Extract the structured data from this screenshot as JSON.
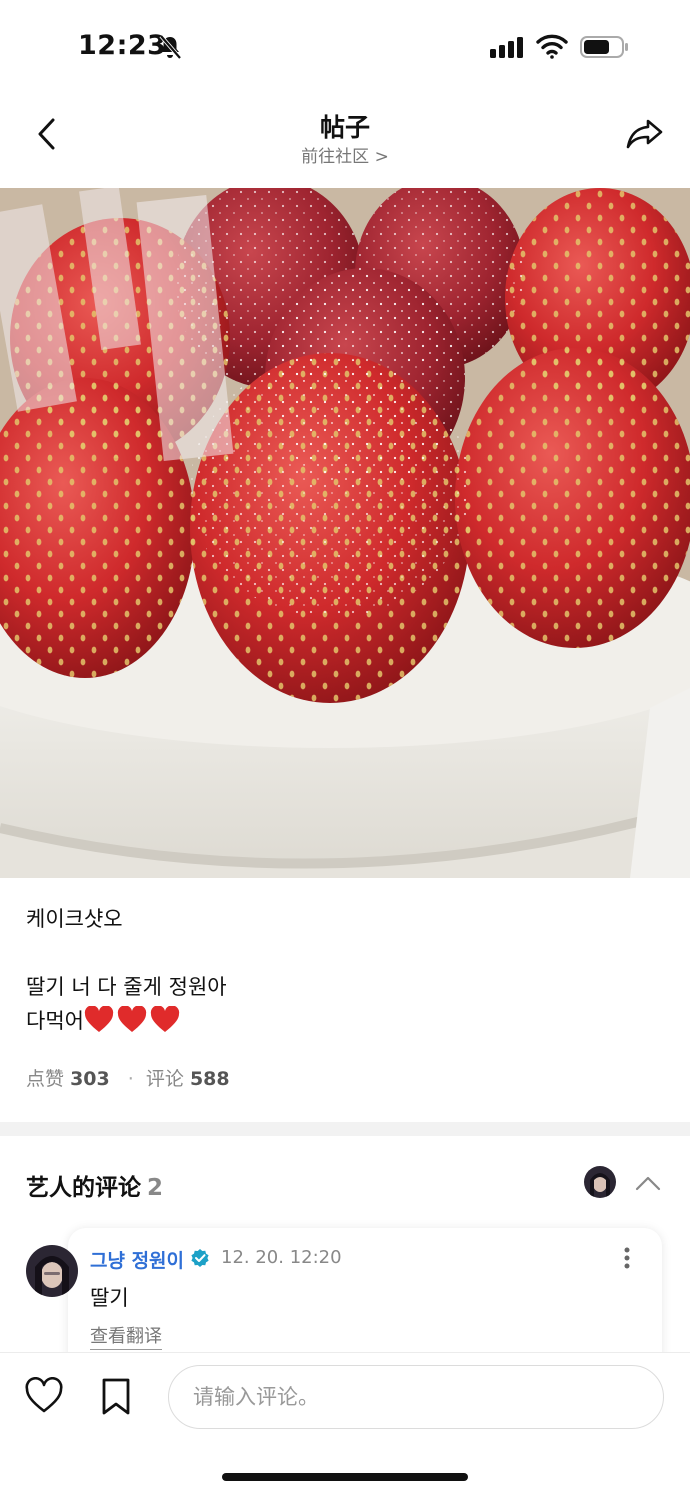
{
  "status_bar": {
    "time": "12:23"
  },
  "nav": {
    "title": "帖子",
    "subtitle": "前往社区 >"
  },
  "post": {
    "line1": "케이크샷오",
    "line2": "딸기 너 다 줄게 정원아",
    "line3": "다먹어",
    "hearts": 3,
    "likes_label": "点赞",
    "likes_count": "303",
    "comments_label": "评论",
    "comments_count": "588"
  },
  "artist_comments": {
    "title": "艺人的评论",
    "count": "2",
    "comment": {
      "author": "그냥 정원이",
      "time": "12. 20. 12:20",
      "body": "딸기",
      "translate_label": "查看翻译"
    }
  },
  "bottom_bar": {
    "input_placeholder": "请输入评论。"
  },
  "colors": {
    "accent_blue": "#2f6fd6",
    "heart_red": "#e02b2b",
    "verified": "#1da1c7"
  },
  "icons": [
    "bell-off-icon",
    "signal-icon",
    "wifi-icon",
    "battery-icon",
    "back-arrow-icon",
    "share-icon",
    "heart-icon",
    "verified-icon",
    "more-vertical-icon",
    "chevron-up-icon",
    "like-heart-icon",
    "bookmark-icon"
  ]
}
